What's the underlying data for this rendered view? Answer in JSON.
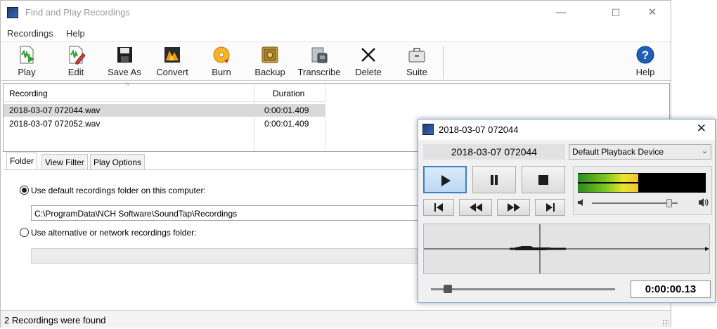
{
  "window": {
    "title": "Find and Play Recordings",
    "minimize": "—",
    "maximize": "☐",
    "close": "✕"
  },
  "menu": {
    "items": [
      "Recordings",
      "Help"
    ]
  },
  "toolbar": {
    "play": "Play",
    "edit": "Edit",
    "save_as": "Save As",
    "convert": "Convert",
    "burn": "Burn",
    "backup": "Backup",
    "transcribe": "Transcribe",
    "delete": "Delete",
    "suite": "Suite",
    "help": "Help"
  },
  "list": {
    "columns": {
      "recording": "Recording",
      "duration": "Duration"
    },
    "rows": [
      {
        "name": "2018-03-07 072044.wav",
        "duration": "0:00:01.409"
      },
      {
        "name": "2018-03-07 072052.wav",
        "duration": "0:00:01.409"
      }
    ]
  },
  "tabs": [
    "Folder",
    "View Filter",
    "Play Options"
  ],
  "folder": {
    "default_option": "Use default recordings folder on this computer:",
    "default_path": "C:\\ProgramData\\NCH Software\\SoundTap\\Recordings",
    "alt_option": "Use alternative or network recordings folder:",
    "alt_path": ""
  },
  "status": {
    "text": "2 Recordings were found"
  },
  "player": {
    "title": "2018-03-07 072044",
    "file_label": "2018-03-07 072044",
    "device": "Default Playback Device",
    "time": "0:00:00.13",
    "volume_level": 0.9,
    "seek_position": 0.09,
    "meter_level": 0.47
  }
}
